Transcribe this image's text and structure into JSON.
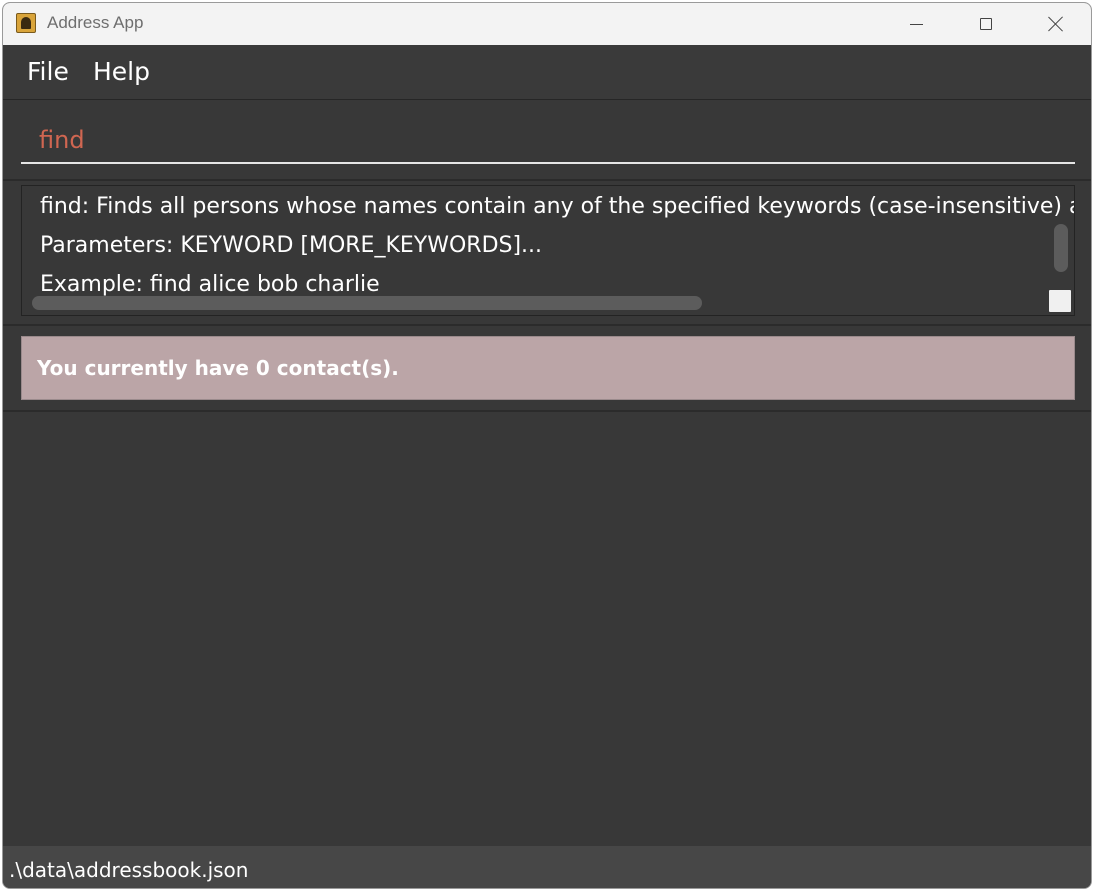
{
  "window": {
    "title": "Address App"
  },
  "menu": {
    "file": "File",
    "help": "Help"
  },
  "command_box": {
    "value": "find",
    "text_color": "#d06651"
  },
  "result_display": {
    "lines": [
      "find: Finds all persons whose names contain any of the specified keywords (case-insensitive) a",
      "Parameters: KEYWORD [MORE_KEYWORDS]...",
      "Example: find alice bob charlie"
    ]
  },
  "status": {
    "message": "You currently have 0 contact(s).",
    "badge_color": "#bba5a7"
  },
  "footer": {
    "save_path": ".\\data\\addressbook.json"
  },
  "icons": {
    "app": "address-book-icon",
    "minimize": "minimize-icon",
    "maximize": "maximize-icon",
    "close": "close-icon"
  },
  "theme": {
    "background": "#383838",
    "titlebar": "#f3f3f3"
  }
}
